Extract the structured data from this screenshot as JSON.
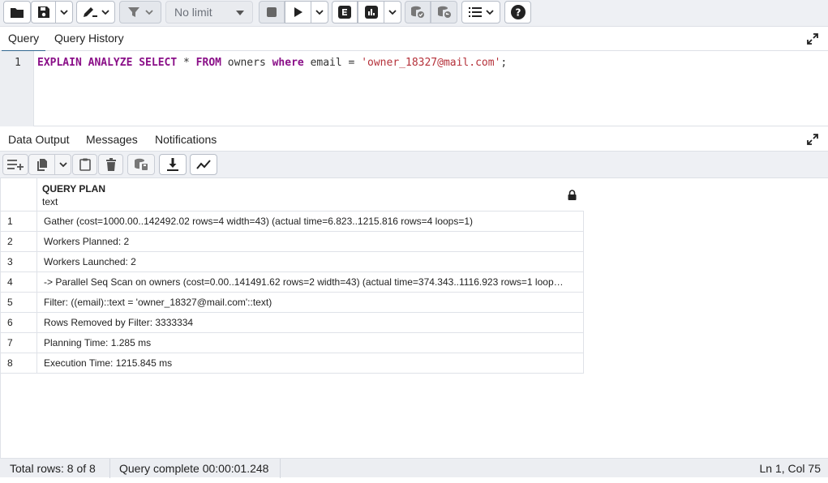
{
  "toolbar": {
    "row_limit": "No limit",
    "icons": [
      "folder-icon",
      "save-icon",
      "chevron-down-icon",
      "pen-edit-icon",
      "chevron-down-icon",
      "filter-icon",
      "chevron-down-icon",
      "stop-icon",
      "play-icon",
      "chevron-down-icon",
      "explain-icon",
      "explain-analyze-icon",
      "chevron-down-icon",
      "commit-icon",
      "rollback-icon",
      "macros-icon",
      "help-icon"
    ]
  },
  "query_tabs": {
    "query": "Query",
    "history": "Query History"
  },
  "editor": {
    "line_number": "1",
    "tokens": {
      "kw1": "EXPLAIN ANALYZE SELECT",
      "star": " * ",
      "kw2": "FROM",
      "table": " owners ",
      "kw3": "where",
      "cond": " email = ",
      "str": "'owner_18327@mail.com'",
      "end": ";"
    }
  },
  "output_tabs": {
    "data": "Data Output",
    "messages": "Messages",
    "notifications": "Notifications"
  },
  "output_toolbar": {
    "icons": [
      "add-row-icon",
      "copy-icon",
      "chevron-down-icon",
      "paste-icon",
      "delete-icon",
      "save-data-icon",
      "download-icon",
      "graph-icon"
    ]
  },
  "grid": {
    "column_name": "QUERY PLAN",
    "column_type": "text",
    "rows": [
      {
        "n": "1",
        "text": "Gather (cost=1000.00..142492.02 rows=4 width=43) (actual time=6.823..1215.816 rows=4 loops=1)"
      },
      {
        "n": "2",
        "text": "Workers Planned: 2"
      },
      {
        "n": "3",
        "text": "Workers Launched: 2"
      },
      {
        "n": "4",
        "text": "-> Parallel Seq Scan on owners (cost=0.00..141491.62 rows=2 width=43) (actual time=374.343..1116.923 rows=1 loop…"
      },
      {
        "n": "5",
        "text": "Filter: ((email)::text = 'owner_18327@mail.com'::text)"
      },
      {
        "n": "6",
        "text": "Rows Removed by Filter: 3333334"
      },
      {
        "n": "7",
        "text": "Planning Time: 1.285 ms"
      },
      {
        "n": "8",
        "text": "Execution Time: 1215.845 ms"
      }
    ]
  },
  "status": {
    "total_rows": "Total rows: 8 of 8",
    "query_complete": "Query complete 00:00:01.248",
    "position": "Ln 1, Col 75"
  },
  "colors": {
    "accent": "#326690",
    "keyword": "#8a0f88",
    "string": "#b5313a"
  }
}
